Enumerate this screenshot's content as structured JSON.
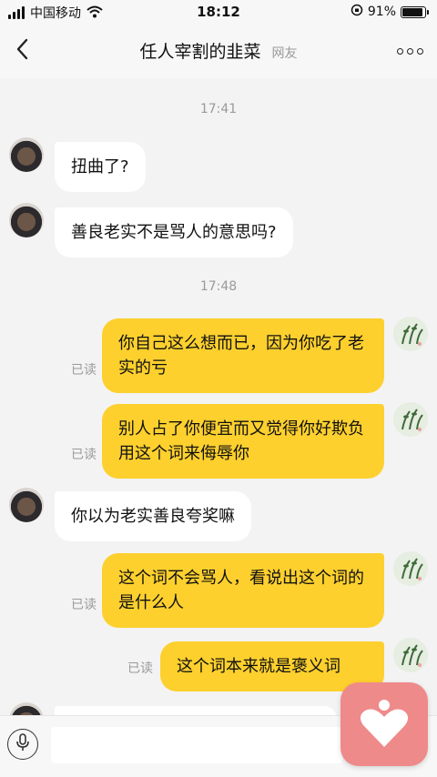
{
  "status_bar": {
    "carrier": "中国移动",
    "time": "18:12",
    "battery": "91%",
    "battery_level": 0.91
  },
  "nav": {
    "title": "任人宰割的韭菜",
    "subtitle": "网友",
    "back_icon": "chevron-left-icon",
    "more_icon": "more-dots-icon"
  },
  "chat": {
    "timestamps": [
      "17:41",
      "17:48"
    ],
    "messages": [
      {
        "from": "friend",
        "text": "扭曲了?"
      },
      {
        "from": "friend",
        "text": "善良老实不是骂人的意思吗?"
      },
      {
        "from": "self",
        "text": "你自己这么想而已，因为你吃了老实的亏",
        "status": "已读"
      },
      {
        "from": "self",
        "text": "别人占了你便宜而又觉得你好欺负用这个词来侮辱你",
        "status": "已读"
      },
      {
        "from": "friend",
        "text": "你以为老实善良夸奖嘛"
      },
      {
        "from": "self",
        "text": "这个词不会骂人，看说出这个词的是什么人",
        "status": "已读"
      },
      {
        "from": "self",
        "text": "这个词本来就是褒义词",
        "status": "已读"
      }
    ]
  },
  "input": {
    "voice_icon": "microphone-icon",
    "fab_icon": "heart-person-icon",
    "fab_color": "#ef8a8a",
    "bubble_out_color": "#fdd02e"
  }
}
